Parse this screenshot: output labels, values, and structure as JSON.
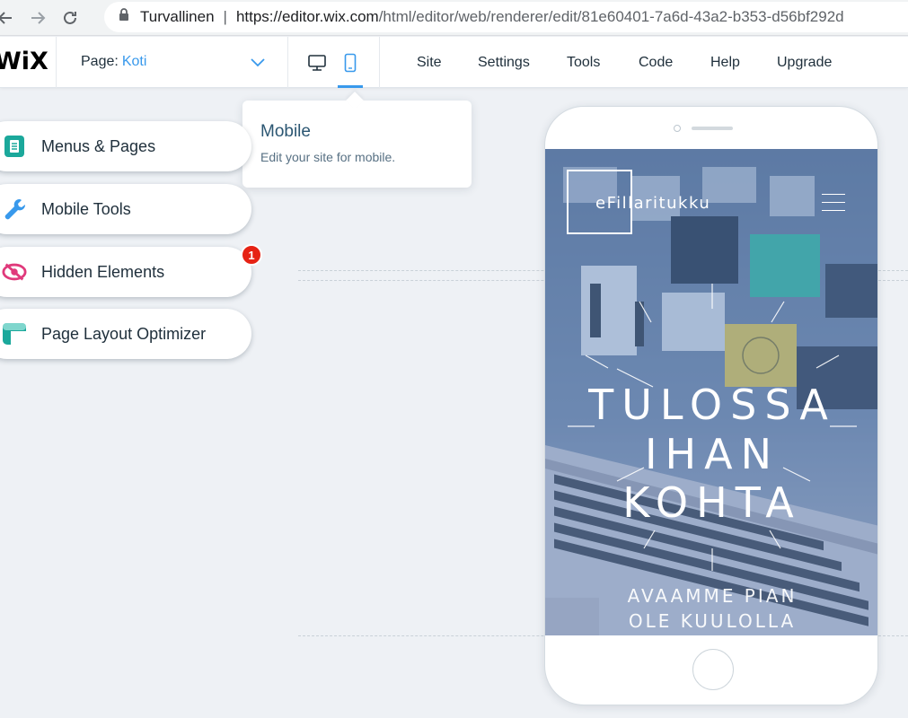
{
  "browser": {
    "secure_label": "Turvallinen",
    "url_host": "https://editor.wix.com",
    "url_path": "/html/editor/web/renderer/edit/81e60401-7a6d-43a2-b353-d56bf292d"
  },
  "topbar": {
    "logo": "WiX",
    "page_label": "Page:",
    "page_value": "Koti",
    "menu": [
      "Site",
      "Settings",
      "Tools",
      "Code",
      "Help",
      "Upgrade"
    ]
  },
  "tooltip": {
    "title": "Mobile",
    "subtitle": "Edit your site for mobile."
  },
  "side_panel": {
    "items": [
      {
        "label": "Menus & Pages",
        "icon": "menus-pages-icon"
      },
      {
        "label": "Mobile Tools",
        "icon": "wrench-icon"
      },
      {
        "label": "Hidden Elements",
        "icon": "hidden-eye-icon"
      },
      {
        "label": "Page Layout Optimizer",
        "icon": "layout-optimizer-icon"
      }
    ],
    "hidden_badge": "1"
  },
  "phone_site": {
    "brand": "eFillaritukku",
    "hero": [
      "TULOSSA",
      "IHAN",
      "KOHTA"
    ],
    "sub": [
      "AVAAMME PIAN",
      "OLE KUULOLLA"
    ]
  },
  "colors": {
    "accent": "#3899ec",
    "badge": "#e62214",
    "teal": "#1ba89b",
    "pink": "#e0397b"
  }
}
